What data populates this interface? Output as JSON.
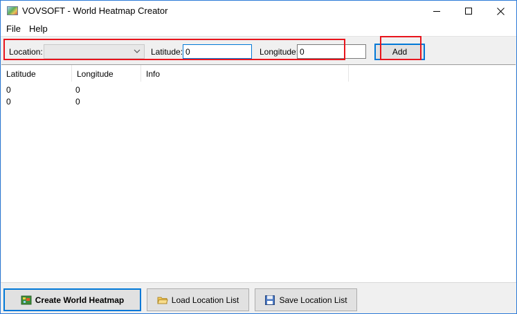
{
  "window": {
    "title": "VOVSOFT - World Heatmap Creator"
  },
  "menu": {
    "file": "File",
    "help": "Help"
  },
  "toolbar": {
    "location_label": "Location:",
    "location_value": "",
    "latitude_label": "Latitude:",
    "latitude_value": "0",
    "longitude_label": "Longitude:",
    "longitude_value": "0",
    "add_label": "Add"
  },
  "list": {
    "columns": [
      "Latitude",
      "Longitude",
      "Info"
    ],
    "rows": [
      {
        "latitude": "0",
        "longitude": "0",
        "info": ""
      },
      {
        "latitude": "0",
        "longitude": "0",
        "info": ""
      }
    ]
  },
  "bottom": {
    "create_label": "Create World Heatmap",
    "load_label": "Load Location List",
    "save_label": "Save Location List"
  },
  "colors": {
    "accent": "#0078d7",
    "highlight": "#e8141c"
  },
  "icons": {
    "app": "world-map-icon",
    "create": "heatmap-icon",
    "load": "folder-open-icon",
    "save": "floppy-disk-icon"
  }
}
